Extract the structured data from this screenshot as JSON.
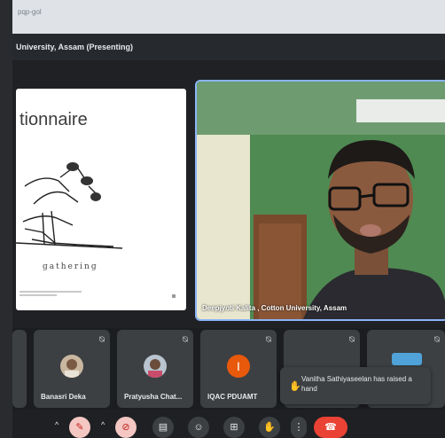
{
  "browser": {
    "tab_text": "pqp-gol"
  },
  "meeting": {
    "presenter_title": "University, Assam (Presenting)"
  },
  "slide": {
    "title": "tionnaire",
    "word": "gathering"
  },
  "speaker": {
    "name": "Deepjyoti Kalita , Cotton University, Assam"
  },
  "participants": [
    {
      "name": "Banasri Deka"
    },
    {
      "name": "Pratyusha Chat..."
    },
    {
      "name": "IQAC PDUAMT",
      "avatar_letter": "I",
      "avatar_color": "#e8590c"
    }
  ],
  "notification": {
    "text": "Vanitha Sathiyaseelan has raised a hand"
  },
  "colors": {
    "accent": "#8ab4f8",
    "end_call": "#ea4335",
    "mic_off_bg": "#f4c7c3"
  },
  "controls": [
    {
      "name": "mic-off-icon",
      "glyph": "✎"
    },
    {
      "name": "camera-off-icon",
      "glyph": "⊘"
    },
    {
      "name": "captions-icon",
      "glyph": "▤"
    },
    {
      "name": "emoji-icon",
      "glyph": "☺"
    },
    {
      "name": "present-icon",
      "glyph": "⊞"
    },
    {
      "name": "raise-hand-icon",
      "glyph": "✋"
    },
    {
      "name": "more-options-icon",
      "glyph": "⋮"
    },
    {
      "name": "end-call-icon",
      "glyph": "☎"
    }
  ]
}
